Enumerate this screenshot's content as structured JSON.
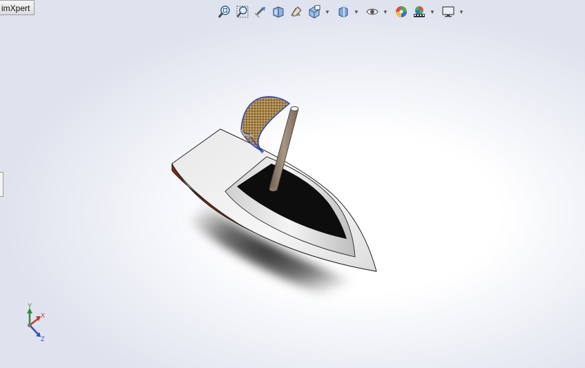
{
  "tab": {
    "label": "imXpert"
  },
  "toolbar": {
    "buttons": [
      {
        "name": "zoom-to-fit-icon"
      },
      {
        "name": "zoom-to-area-icon"
      },
      {
        "name": "previous-view-icon"
      },
      {
        "name": "section-view-icon"
      },
      {
        "name": "dynamic-annotation-icon"
      },
      {
        "name": "view-orientation-icon",
        "dropdown": true
      },
      {
        "name": "display-style-icon",
        "dropdown": true
      },
      {
        "name": "hide-show-items-icon",
        "dropdown": true
      },
      {
        "name": "edit-appearance-icon"
      },
      {
        "name": "apply-scene-icon",
        "dropdown": true
      },
      {
        "name": "view-settings-icon",
        "dropdown": true
      }
    ],
    "caret": "▼"
  },
  "triad": {
    "x_label": "X",
    "y_label": "Y",
    "z_label": "Z"
  },
  "colors": {
    "hull_side": "#7a2f1f",
    "deck": "#f0f0f0",
    "cockpit": "#0d0d0d",
    "mast": "#8b7866",
    "sail": "#9c7a3e",
    "sail_edge": "#1f3fd0"
  }
}
